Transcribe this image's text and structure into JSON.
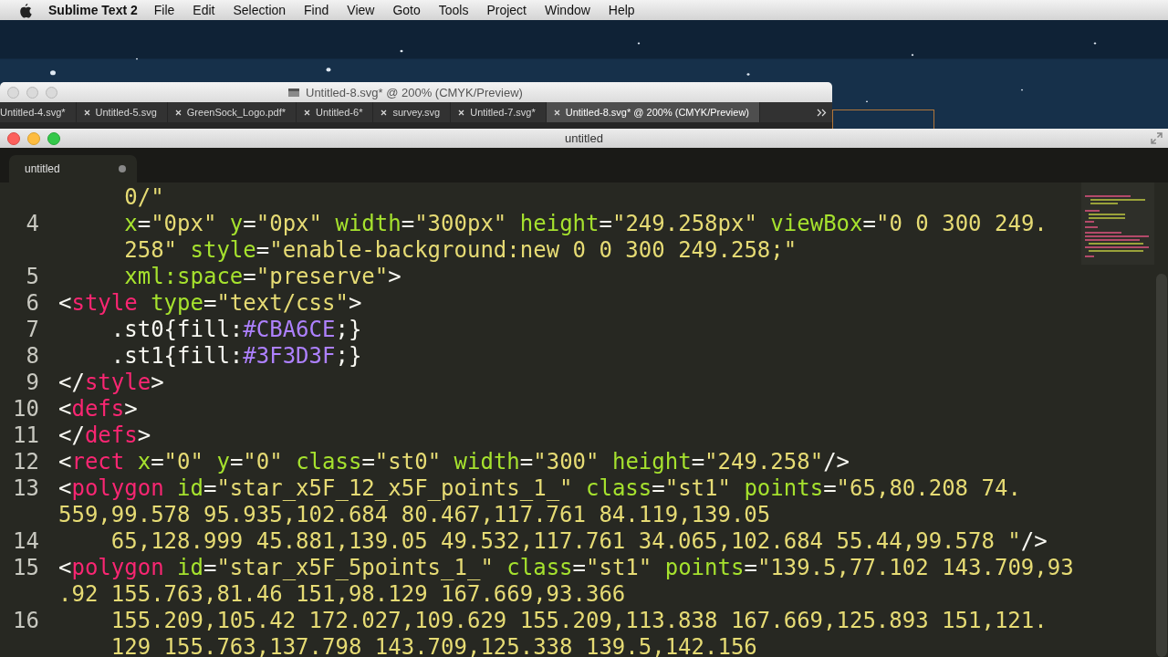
{
  "menu_bar": {
    "app_name": "Sublime Text 2",
    "menus": [
      "File",
      "Edit",
      "Selection",
      "Find",
      "View",
      "Goto",
      "Tools",
      "Project",
      "Window",
      "Help"
    ]
  },
  "background_window": {
    "title": "Untitled-8.svg* @ 200% (CMYK/Preview)",
    "tabs": [
      {
        "label": "Untitled-4.svg*",
        "selected": false,
        "closable": false
      },
      {
        "label": "Untitled-5.svg",
        "selected": false,
        "closable": true
      },
      {
        "label": "GreenSock_Logo.pdf*",
        "selected": false,
        "closable": true
      },
      {
        "label": "Untitled-6*",
        "selected": false,
        "closable": true
      },
      {
        "label": "survey.svg",
        "selected": false,
        "closable": true
      },
      {
        "label": "Untitled-7.svg*",
        "selected": false,
        "closable": true
      },
      {
        "label": "Untitled-8.svg* @ 200% (CMYK/Preview)",
        "selected": true,
        "closable": true
      }
    ]
  },
  "editor": {
    "title": "untitled",
    "tabs": [
      {
        "label": "untitled",
        "selected": true,
        "modified": true
      }
    ],
    "lines": [
      {
        "tokens": [
          {
            "kind": "string",
            "text": "     0/\""
          }
        ]
      },
      {
        "number": "4",
        "tokens": [
          {
            "kind": "attr",
            "text": "     x"
          },
          {
            "kind": "plain",
            "text": "="
          },
          {
            "kind": "string",
            "text": "\"0px\""
          },
          {
            "kind": "attr",
            "text": " y"
          },
          {
            "kind": "plain",
            "text": "="
          },
          {
            "kind": "string",
            "text": "\"0px\""
          },
          {
            "kind": "attr",
            "text": " width"
          },
          {
            "kind": "plain",
            "text": "="
          },
          {
            "kind": "string",
            "text": "\"300px\""
          },
          {
            "kind": "attr",
            "text": " height"
          },
          {
            "kind": "plain",
            "text": "="
          },
          {
            "kind": "string",
            "text": "\"249.258px\""
          },
          {
            "kind": "attr",
            "text": " viewBox"
          },
          {
            "kind": "plain",
            "text": "="
          },
          {
            "kind": "string",
            "text": "\"0 0 300 249."
          }
        ]
      },
      {
        "tokens": [
          {
            "kind": "string",
            "text": "     258\""
          },
          {
            "kind": "attr",
            "text": " style"
          },
          {
            "kind": "plain",
            "text": "="
          },
          {
            "kind": "string",
            "text": "\"enable-background:new 0 0 300 249.258;\""
          }
        ]
      },
      {
        "number": "5",
        "tokens": [
          {
            "kind": "attr",
            "text": "     xml:space"
          },
          {
            "kind": "plain",
            "text": "="
          },
          {
            "kind": "string",
            "text": "\"preserve\""
          },
          {
            "kind": "plain",
            "text": ">"
          }
        ]
      },
      {
        "number": "6",
        "tokens": [
          {
            "kind": "plain",
            "text": "<"
          },
          {
            "kind": "tag",
            "text": "style"
          },
          {
            "kind": "attr",
            "text": " type"
          },
          {
            "kind": "plain",
            "text": "="
          },
          {
            "kind": "string",
            "text": "\"text/css\""
          },
          {
            "kind": "plain",
            "text": ">"
          }
        ]
      },
      {
        "number": "7",
        "tokens": [
          {
            "kind": "plain",
            "text": "    .st0{fill:"
          },
          {
            "kind": "constant",
            "text": "#CBA6CE"
          },
          {
            "kind": "plain",
            "text": ";}"
          }
        ]
      },
      {
        "number": "8",
        "tokens": [
          {
            "kind": "plain",
            "text": "    .st1{fill:"
          },
          {
            "kind": "constant",
            "text": "#3F3D3F"
          },
          {
            "kind": "plain",
            "text": ";}"
          }
        ]
      },
      {
        "number": "9",
        "tokens": [
          {
            "kind": "plain",
            "text": "</"
          },
          {
            "kind": "tag",
            "text": "style"
          },
          {
            "kind": "plain",
            "text": ">"
          }
        ]
      },
      {
        "number": "10",
        "tokens": [
          {
            "kind": "plain",
            "text": "<"
          },
          {
            "kind": "tag",
            "text": "defs"
          },
          {
            "kind": "plain",
            "text": ">"
          }
        ]
      },
      {
        "number": "11",
        "tokens": [
          {
            "kind": "plain",
            "text": "</"
          },
          {
            "kind": "tag",
            "text": "defs"
          },
          {
            "kind": "plain",
            "text": ">"
          }
        ]
      },
      {
        "number": "12",
        "tokens": [
          {
            "kind": "plain",
            "text": "<"
          },
          {
            "kind": "tag",
            "text": "rect"
          },
          {
            "kind": "attr",
            "text": " x"
          },
          {
            "kind": "plain",
            "text": "="
          },
          {
            "kind": "string",
            "text": "\"0\""
          },
          {
            "kind": "attr",
            "text": " y"
          },
          {
            "kind": "plain",
            "text": "="
          },
          {
            "kind": "string",
            "text": "\"0\""
          },
          {
            "kind": "attr",
            "text": " class"
          },
          {
            "kind": "plain",
            "text": "="
          },
          {
            "kind": "string",
            "text": "\"st0\""
          },
          {
            "kind": "attr",
            "text": " width"
          },
          {
            "kind": "plain",
            "text": "="
          },
          {
            "kind": "string",
            "text": "\"300\""
          },
          {
            "kind": "attr",
            "text": " height"
          },
          {
            "kind": "plain",
            "text": "="
          },
          {
            "kind": "string",
            "text": "\"249.258\""
          },
          {
            "kind": "plain",
            "text": "/>"
          }
        ]
      },
      {
        "number": "13",
        "tokens": [
          {
            "kind": "plain",
            "text": "<"
          },
          {
            "kind": "tag",
            "text": "polygon"
          },
          {
            "kind": "attr",
            "text": " id"
          },
          {
            "kind": "plain",
            "text": "="
          },
          {
            "kind": "string",
            "text": "\"star_x5F_12_x5F_points_1_\""
          },
          {
            "kind": "attr",
            "text": " class"
          },
          {
            "kind": "plain",
            "text": "="
          },
          {
            "kind": "string",
            "text": "\"st1\""
          },
          {
            "kind": "attr",
            "text": " points"
          },
          {
            "kind": "plain",
            "text": "="
          },
          {
            "kind": "string",
            "text": "\"65,80.208 74."
          }
        ]
      },
      {
        "tokens": [
          {
            "kind": "string",
            "text": "559,99.578 95.935,102.684 80.467,117.761 84.119,139.05"
          }
        ]
      },
      {
        "number": "14",
        "tokens": [
          {
            "kind": "string",
            "text": "    65,128.999 45.881,139.05 49.532,117.761 34.065,102.684 55.44,99.578 \""
          },
          {
            "kind": "plain",
            "text": "/>"
          }
        ]
      },
      {
        "number": "15",
        "tokens": [
          {
            "kind": "plain",
            "text": "<"
          },
          {
            "kind": "tag",
            "text": "polygon"
          },
          {
            "kind": "attr",
            "text": " id"
          },
          {
            "kind": "plain",
            "text": "="
          },
          {
            "kind": "string",
            "text": "\"star_x5F_5points_1_\""
          },
          {
            "kind": "attr",
            "text": " class"
          },
          {
            "kind": "plain",
            "text": "="
          },
          {
            "kind": "string",
            "text": "\"st1\""
          },
          {
            "kind": "attr",
            "text": " points"
          },
          {
            "kind": "plain",
            "text": "="
          },
          {
            "kind": "string",
            "text": "\"139.5,77.102 143.709,93"
          }
        ]
      },
      {
        "tokens": [
          {
            "kind": "string",
            "text": ".92 155.763,81.46 151,98.129 167.669,93.366"
          }
        ]
      },
      {
        "number": "16",
        "tokens": [
          {
            "kind": "string",
            "text": "    155.209,105.42 172.027,109.629 155.209,113.838 167.669,125.893 151,121."
          }
        ]
      },
      {
        "tokens": [
          {
            "kind": "string",
            "text": "    129 155.763,137.798 143.709,125.338 139.5,142.156"
          }
        ]
      }
    ]
  }
}
